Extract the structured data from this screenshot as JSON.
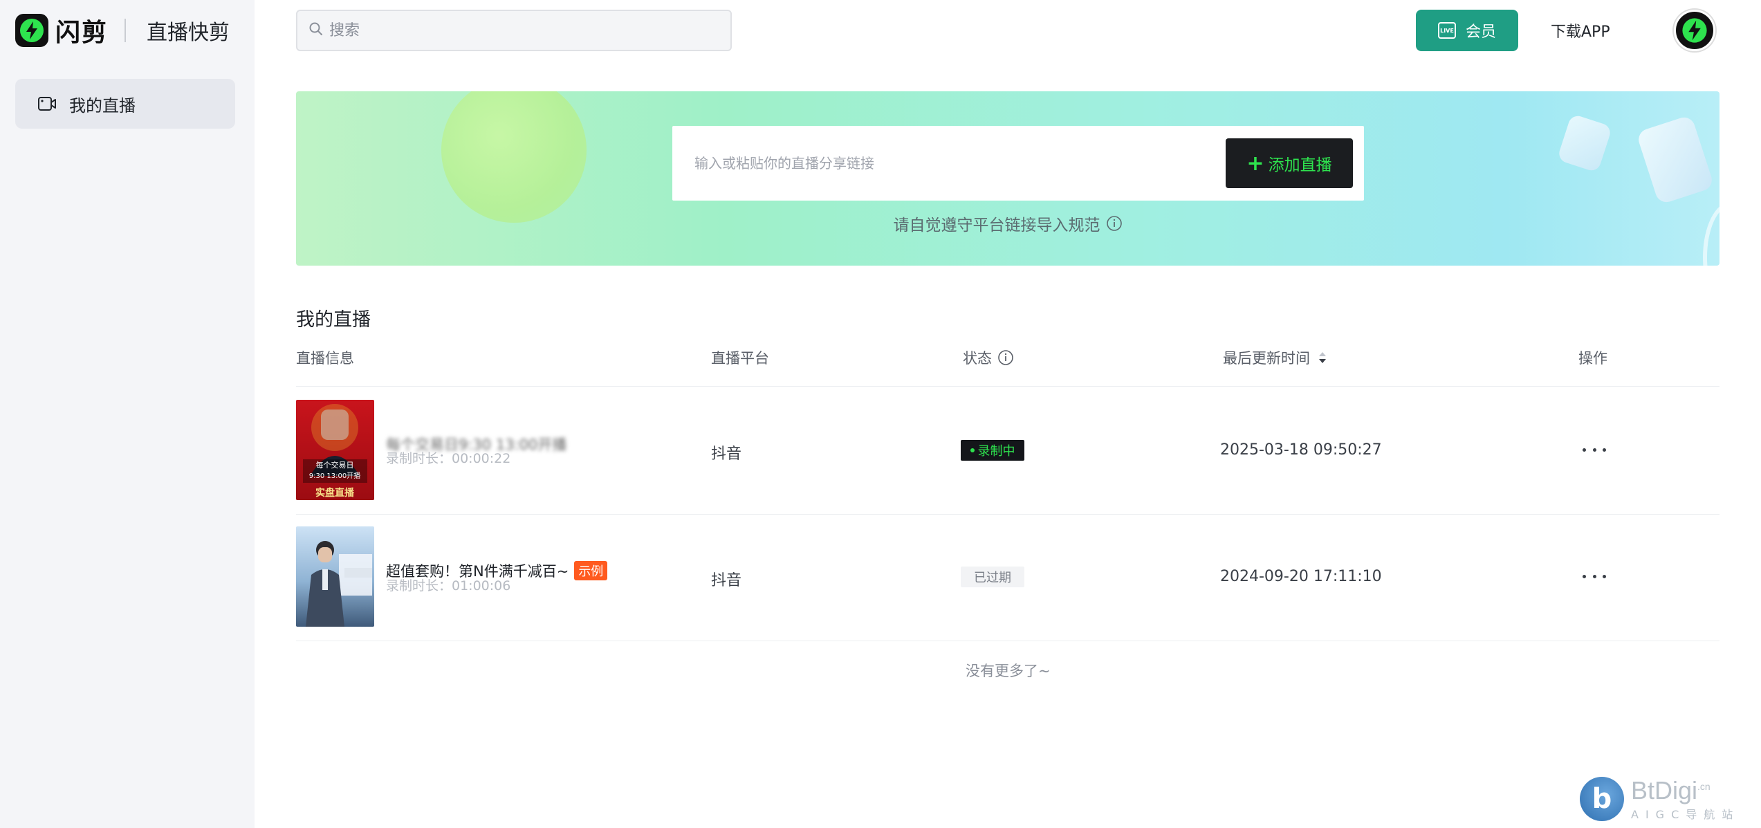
{
  "app": {
    "name": "闪剪",
    "product": "直播快剪"
  },
  "sidebar": {
    "items": [
      {
        "label": "我的直播",
        "icon": "video-camera-icon",
        "active": true
      }
    ]
  },
  "header": {
    "search_placeholder": "搜索",
    "vip_label": "会员",
    "vip_icon_text": "LIVE",
    "download_label": "下载APP"
  },
  "banner": {
    "input_placeholder": "输入或粘贴你的直播分享链接",
    "add_button_label": "添加直播",
    "notice": "请自觉遵守平台链接导入规范"
  },
  "table": {
    "title": "我的直播",
    "columns": [
      "直播信息",
      "直播平台",
      "状态",
      "最后更新时间",
      "操作"
    ],
    "rows": [
      {
        "title": "每个交易日9:30 13:00开播",
        "duration": "录制时长：00:00:22",
        "platform": "抖音",
        "status": "录制中",
        "updated": "2025-03-18 09:50:27",
        "thumb_text_1": "每个交易日",
        "thumb_text_2": "9:30 13:00开播",
        "thumb_text_3": "实盘直播"
      },
      {
        "title": "超值套购！第N件满千减百~",
        "tag": "示例",
        "duration": "录制时长：01:00:06",
        "platform": "抖音",
        "status": "已过期",
        "updated": "2024-09-20 17:11:10"
      }
    ],
    "footer": "没有更多了~"
  },
  "watermark": {
    "brand": "BtDigi",
    "suffix": ".cn",
    "sub": "AIGC导航站"
  },
  "colors": {
    "primary": "#1f9e84",
    "accent_green": "#2ee34e",
    "sidebar_bg": "#f4f5f8",
    "tag_orange": "#ff5a1f"
  }
}
